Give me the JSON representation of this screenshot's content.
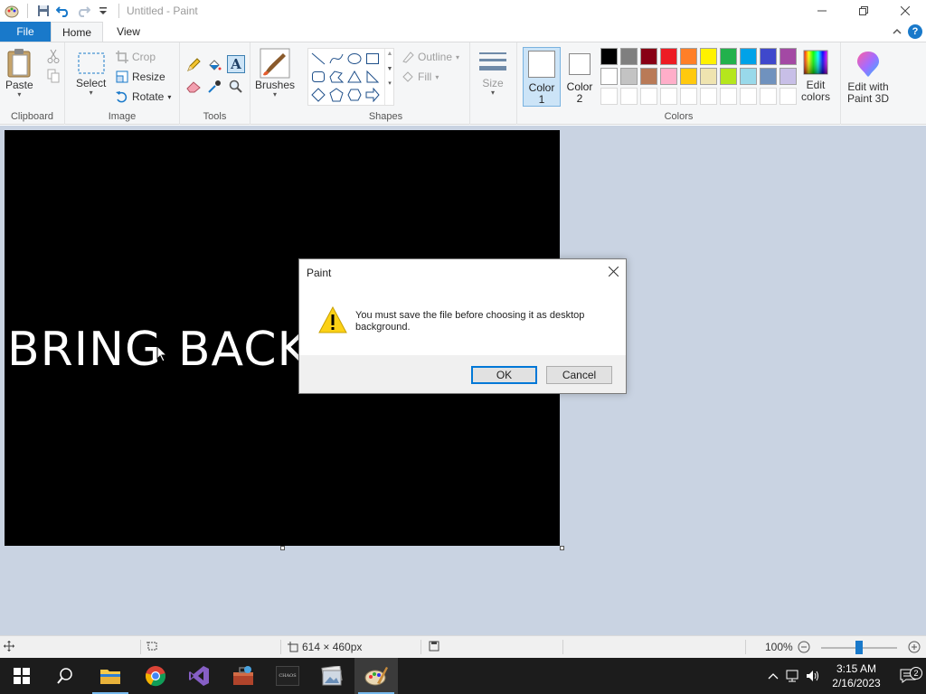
{
  "window": {
    "title": "Untitled - Paint",
    "controls": [
      "minimize",
      "maximize",
      "close"
    ]
  },
  "ribbon_tabs": {
    "file": "File",
    "home": "Home",
    "view": "View"
  },
  "clipboard": {
    "paste": "Paste",
    "group": "Clipboard"
  },
  "image": {
    "select": "Select",
    "crop": "Crop",
    "resize": "Resize",
    "rotate": "Rotate",
    "group": "Image"
  },
  "tools": {
    "group": "Tools"
  },
  "brushes": {
    "label": "Brushes"
  },
  "shapes": {
    "outline": "Outline",
    "fill": "Fill",
    "group": "Shapes"
  },
  "size": {
    "label": "Size"
  },
  "colors": {
    "color1_line1": "Color",
    "color1_line2": "1",
    "color2_line1": "Color",
    "color2_line2": "2",
    "edit_line1": "Edit",
    "edit_line2": "colors",
    "group": "Colors",
    "color1_value": "#ffffff",
    "color2_value": "#ffffff",
    "row1": [
      "#000000",
      "#7f7f7f",
      "#880015",
      "#ed1c24",
      "#ff7f27",
      "#fff200",
      "#22b14c",
      "#00a2e8",
      "#3f48cc",
      "#a349a4"
    ],
    "row2": [
      "#ffffff",
      "#c3c3c3",
      "#b97a57",
      "#ffaec9",
      "#ffc90e",
      "#efe4b0",
      "#b5e61d",
      "#99d9ea",
      "#7092be",
      "#c8bfe7"
    ]
  },
  "paint3d": {
    "line1": "Edit with",
    "line2": "Paint 3D"
  },
  "canvas": {
    "text": "BRING BACK"
  },
  "dialog": {
    "title": "Paint",
    "message": "You must save the file before choosing it as desktop background.",
    "ok": "OK",
    "cancel": "Cancel"
  },
  "statusbar": {
    "dimensions": "614 × 460px",
    "zoom": "100%"
  },
  "taskbar": {
    "time": "3:15 AM",
    "date": "2/16/2023",
    "notifications": "2",
    "chaos_label": "CHAOS"
  }
}
